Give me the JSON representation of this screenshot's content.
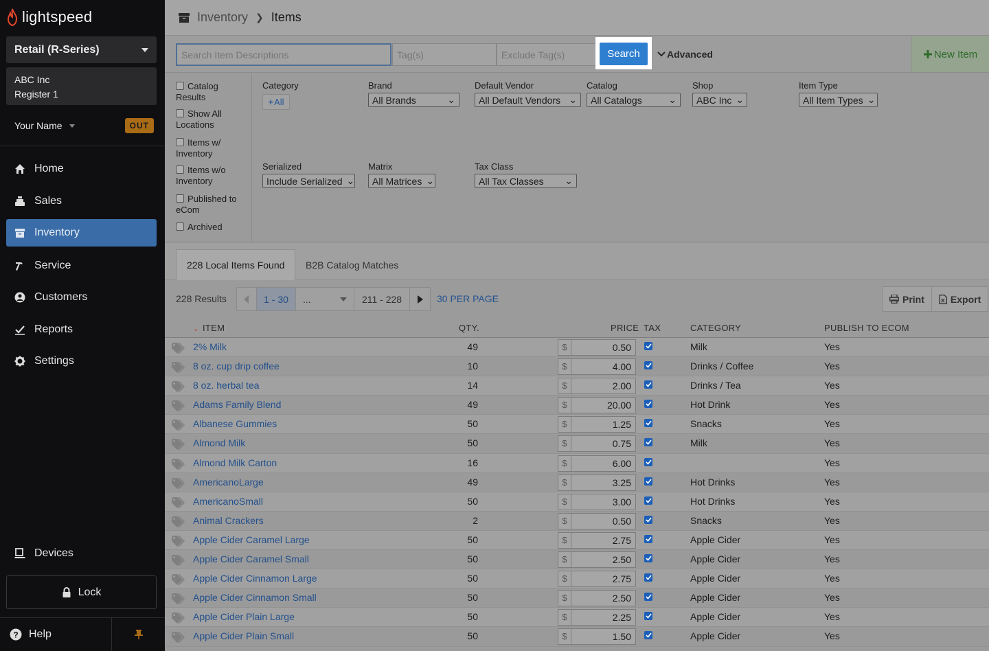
{
  "app": {
    "logo_text": "lightspeed"
  },
  "sidebar": {
    "account": "Retail (R-Series)",
    "store_name": "ABC Inc",
    "register": "Register 1",
    "user_name": "Your Name",
    "out_label": "OUT",
    "nav": [
      {
        "label": "Home",
        "icon": "home-icon"
      },
      {
        "label": "Sales",
        "icon": "cash-register-icon"
      },
      {
        "label": "Inventory",
        "icon": "inventory-box-icon"
      },
      {
        "label": "Service",
        "icon": "hammer-icon"
      },
      {
        "label": "Customers",
        "icon": "person-icon"
      },
      {
        "label": "Reports",
        "icon": "chart-check-icon"
      },
      {
        "label": "Settings",
        "icon": "gear-icon"
      }
    ],
    "devices_label": "Devices",
    "lock_label": "Lock",
    "help_label": "Help"
  },
  "breadcrumb": {
    "section": "Inventory",
    "page": "Items"
  },
  "search": {
    "description_placeholder": "Search Item Descriptions",
    "tags_placeholder": "Tag(s)",
    "exclude_tags_placeholder": "Exclude Tag(s)",
    "search_label": "Search",
    "advanced_label": "Advanced",
    "new_item_label": "New Item"
  },
  "filters": {
    "checkboxes": [
      {
        "label": "Catalog Results"
      },
      {
        "label": "Show All Locations"
      },
      {
        "label": "Items w/ Inventory"
      },
      {
        "label": "Items w/o Inventory"
      },
      {
        "label": "Published to eCom"
      },
      {
        "label": "Archived"
      }
    ],
    "category_label": "Category",
    "category_all": "All",
    "brand_label": "Brand",
    "brand_value": "All Brands",
    "vendor_label": "Default Vendor",
    "vendor_value": "All Default Vendors",
    "catalog_label": "Catalog",
    "catalog_value": "All Catalogs",
    "shop_label": "Shop",
    "shop_value": "ABC Inc",
    "item_type_label": "Item Type",
    "item_type_value": "All Item Types",
    "serialized_label": "Serialized",
    "serialized_value": "Include Serialized",
    "matrix_label": "Matrix",
    "matrix_value": "All Matrices",
    "tax_class_label": "Tax Class",
    "tax_class_value": "All Tax Classes"
  },
  "tabs": {
    "local": "228 Local Items Found",
    "b2b": "B2B Catalog Matches"
  },
  "pager": {
    "results": "228 Results",
    "current_range": "1 - 30",
    "ellipsis": "...",
    "last_range": "211 - 228",
    "per_page": "30 PER PAGE",
    "print_label": "Print",
    "export_label": "Export"
  },
  "table": {
    "headers": {
      "item": "ITEM",
      "qty": "QTY.",
      "price": "PRICE",
      "tax": "TAX",
      "category": "CATEGORY",
      "publish": "PUBLISH TO ECOM"
    },
    "currency": "$",
    "rows": [
      {
        "name": "2% Milk",
        "qty": "49",
        "price": "0.50",
        "category": "Milk",
        "publish": "Yes"
      },
      {
        "name": "8 oz. cup drip coffee",
        "qty": "10",
        "price": "4.00",
        "category": "Drinks / Coffee",
        "publish": "Yes"
      },
      {
        "name": "8 oz. herbal tea",
        "qty": "14",
        "price": "2.00",
        "category": "Drinks / Tea",
        "publish": "Yes"
      },
      {
        "name": "Adams Family Blend",
        "qty": "49",
        "price": "20.00",
        "category": "Hot Drink",
        "publish": "Yes"
      },
      {
        "name": "Albanese Gummies",
        "qty": "50",
        "price": "1.25",
        "category": "Snacks",
        "publish": "Yes"
      },
      {
        "name": "Almond Milk",
        "qty": "50",
        "price": "0.75",
        "category": "Milk",
        "publish": "Yes"
      },
      {
        "name": "Almond Milk Carton",
        "qty": "16",
        "price": "6.00",
        "category": "",
        "publish": "Yes"
      },
      {
        "name": "AmericanoLarge",
        "qty": "49",
        "price": "3.25",
        "category": "Hot Drinks",
        "publish": "Yes"
      },
      {
        "name": "AmericanoSmall",
        "qty": "50",
        "price": "3.00",
        "category": "Hot Drinks",
        "publish": "Yes"
      },
      {
        "name": "Animal Crackers",
        "qty": "2",
        "price": "0.50",
        "category": "Snacks",
        "publish": "Yes"
      },
      {
        "name": "Apple Cider Caramel Large",
        "qty": "50",
        "price": "2.75",
        "category": "Apple Cider",
        "publish": "Yes"
      },
      {
        "name": "Apple Cider Caramel Small",
        "qty": "50",
        "price": "2.50",
        "category": "Apple Cider",
        "publish": "Yes"
      },
      {
        "name": "Apple Cider Cinnamon Large",
        "qty": "50",
        "price": "2.75",
        "category": "Apple Cider",
        "publish": "Yes"
      },
      {
        "name": "Apple Cider Cinnamon Small",
        "qty": "50",
        "price": "2.50",
        "category": "Apple Cider",
        "publish": "Yes"
      },
      {
        "name": "Apple Cider Plain Large",
        "qty": "50",
        "price": "2.25",
        "category": "Apple Cider",
        "publish": "Yes"
      },
      {
        "name": "Apple Cider Plain Small",
        "qty": "50",
        "price": "1.50",
        "category": "Apple Cider",
        "publish": "Yes"
      }
    ]
  },
  "colors": {
    "sidebar_bg": "#0f0f11",
    "active_nav": "#3a6da8",
    "search_button": "#2f7fd0",
    "link": "#23508c",
    "new_item": "#2e6b2a",
    "out_badge": "#a96b16"
  }
}
